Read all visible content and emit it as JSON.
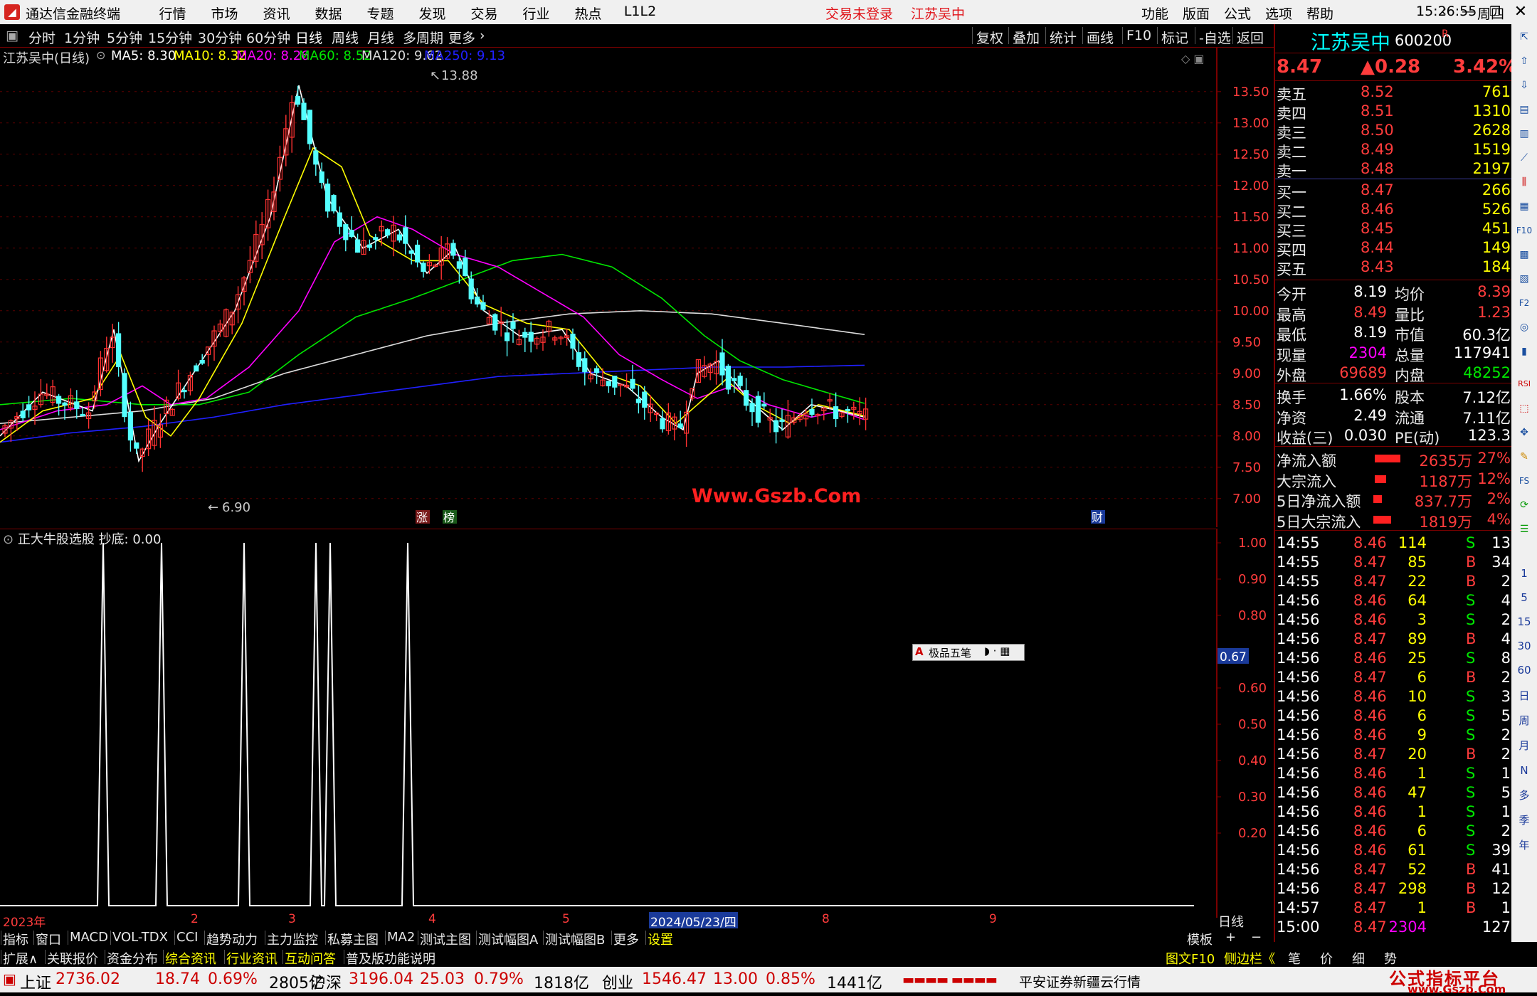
{
  "titlebar": {
    "app_name": "通达信金融终端",
    "menu": [
      "行情",
      "市场",
      "资讯",
      "数据",
      "专题",
      "发现",
      "交易",
      "行业",
      "热点",
      "L1L2"
    ],
    "login_status": "交易未登录",
    "stock_title": "江苏吴中",
    "right_menu": [
      "功能",
      "版面",
      "公式",
      "选项",
      "帮助"
    ],
    "time": "15:26:55",
    "weekday": "周四"
  },
  "toolbar": {
    "periods": [
      "分时",
      "1分钟",
      "5分钟",
      "15分钟",
      "30分钟",
      "60分钟",
      "日线",
      "周线",
      "月线",
      "多周期",
      "更多"
    ],
    "active_period": "日线",
    "right_buttons": [
      "复权",
      "叠加",
      "统计",
      "画线",
      "F10",
      "标记",
      "-自选",
      "返回"
    ]
  },
  "ma_legend": {
    "stock": "江苏吴中(日线)",
    "items": [
      {
        "label": "MA5: 8.30",
        "color": "#ffffff"
      },
      {
        "label": "MA10: 8.32",
        "color": "#ffff00"
      },
      {
        "label": "MA20: 8.26",
        "color": "#ff00ff"
      },
      {
        "label": "MA60: 8.52",
        "color": "#00e600"
      },
      {
        "label": "MA120: 9.62",
        "color": "#dcdcdc"
      },
      {
        "label": "MA250: 9.13",
        "color": "#2020ff"
      }
    ]
  },
  "chart_data": {
    "type": "candlestick",
    "price_axis": [
      "13.50",
      "13.00",
      "12.50",
      "12.00",
      "11.50",
      "11.00",
      "10.50",
      "10.00",
      "9.50",
      "9.00",
      "8.50",
      "8.00",
      "7.50",
      "7.00"
    ],
    "ylim": [
      6.6,
      14.1
    ],
    "high_label": "13.88",
    "low_label": "6.90",
    "date_axis": [
      "2023年",
      "2",
      "3",
      "4",
      "5",
      "2024/05/23/四",
      "8",
      "9"
    ],
    "watermark": "Www.Gszb.Com",
    "markers": [
      "涨",
      "榜",
      "财"
    ],
    "ma_keypoints": {
      "MA5": [
        [
          0,
          8.0
        ],
        [
          60,
          8.7
        ],
        [
          130,
          8.4
        ],
        [
          160,
          9.7
        ],
        [
          195,
          7.6
        ],
        [
          225,
          8.2
        ],
        [
          260,
          8.8
        ],
        [
          330,
          10.0
        ],
        [
          380,
          11.5
        ],
        [
          420,
          13.6
        ],
        [
          460,
          11.8
        ],
        [
          510,
          11.0
        ],
        [
          560,
          11.3
        ],
        [
          600,
          10.6
        ],
        [
          640,
          11.0
        ],
        [
          680,
          10.0
        ],
        [
          730,
          9.6
        ],
        [
          790,
          9.7
        ],
        [
          830,
          9.0
        ],
        [
          880,
          8.8
        ],
        [
          930,
          8.3
        ],
        [
          960,
          8.1
        ],
        [
          980,
          9.0
        ],
        [
          1010,
          9.2
        ],
        [
          1050,
          8.6
        ],
        [
          1100,
          8.1
        ],
        [
          1140,
          8.5
        ],
        [
          1180,
          8.4
        ],
        [
          1215,
          8.3
        ]
      ],
      "MA10": [
        [
          0,
          7.9
        ],
        [
          60,
          8.4
        ],
        [
          130,
          8.6
        ],
        [
          170,
          9.3
        ],
        [
          205,
          8.3
        ],
        [
          240,
          8.0
        ],
        [
          280,
          8.6
        ],
        [
          340,
          9.8
        ],
        [
          400,
          11.5
        ],
        [
          440,
          12.6
        ],
        [
          480,
          12.3
        ],
        [
          520,
          11.2
        ],
        [
          580,
          10.8
        ],
        [
          630,
          10.8
        ],
        [
          680,
          10.1
        ],
        [
          740,
          9.8
        ],
        [
          800,
          9.7
        ],
        [
          850,
          9.0
        ],
        [
          900,
          8.8
        ],
        [
          950,
          8.2
        ],
        [
          990,
          8.6
        ],
        [
          1020,
          8.9
        ],
        [
          1060,
          8.5
        ],
        [
          1110,
          8.2
        ],
        [
          1150,
          8.5
        ],
        [
          1215,
          8.32
        ]
      ],
      "MA20": [
        [
          0,
          8.1
        ],
        [
          80,
          8.4
        ],
        [
          150,
          8.5
        ],
        [
          200,
          8.8
        ],
        [
          240,
          8.5
        ],
        [
          290,
          8.6
        ],
        [
          350,
          9.1
        ],
        [
          420,
          10.0
        ],
        [
          470,
          11.1
        ],
        [
          530,
          11.5
        ],
        [
          580,
          11.3
        ],
        [
          640,
          10.9
        ],
        [
          700,
          10.7
        ],
        [
          760,
          10.3
        ],
        [
          820,
          9.9
        ],
        [
          870,
          9.3
        ],
        [
          930,
          8.9
        ],
        [
          980,
          8.6
        ],
        [
          1030,
          8.8
        ],
        [
          1080,
          8.5
        ],
        [
          1140,
          8.3
        ],
        [
          1180,
          8.4
        ],
        [
          1215,
          8.26
        ]
      ],
      "MA60": [
        [
          0,
          8.5
        ],
        [
          100,
          8.6
        ],
        [
          200,
          8.5
        ],
        [
          280,
          8.5
        ],
        [
          350,
          8.7
        ],
        [
          420,
          9.3
        ],
        [
          500,
          9.9
        ],
        [
          580,
          10.2
        ],
        [
          650,
          10.5
        ],
        [
          720,
          10.8
        ],
        [
          790,
          10.9
        ],
        [
          860,
          10.7
        ],
        [
          930,
          10.2
        ],
        [
          990,
          9.6
        ],
        [
          1040,
          9.2
        ],
        [
          1100,
          8.9
        ],
        [
          1160,
          8.7
        ],
        [
          1215,
          8.52
        ]
      ],
      "MA120": [
        [
          0,
          8.2
        ],
        [
          100,
          8.3
        ],
        [
          200,
          8.4
        ],
        [
          300,
          8.6
        ],
        [
          400,
          9.0
        ],
        [
          500,
          9.3
        ],
        [
          600,
          9.6
        ],
        [
          700,
          9.8
        ],
        [
          800,
          9.95
        ],
        [
          900,
          10.0
        ],
        [
          1000,
          9.95
        ],
        [
          1100,
          9.8
        ],
        [
          1215,
          9.62
        ]
      ],
      "MA250": [
        [
          0,
          7.9
        ],
        [
          100,
          8.05
        ],
        [
          200,
          8.15
        ],
        [
          300,
          8.3
        ],
        [
          400,
          8.5
        ],
        [
          500,
          8.65
        ],
        [
          600,
          8.8
        ],
        [
          700,
          8.95
        ],
        [
          800,
          9.0
        ],
        [
          900,
          9.05
        ],
        [
          1000,
          9.1
        ],
        [
          1100,
          9.1
        ],
        [
          1215,
          9.13
        ]
      ]
    }
  },
  "indicator": {
    "title": "正大牛股选股",
    "value_label": "抄底: 0.00",
    "axis": [
      "1.00",
      "0.90",
      "0.80",
      "0.60",
      "0.50",
      "0.40",
      "0.30",
      "0.20"
    ],
    "cursor_value": "0.67",
    "spikes": [
      145,
      227,
      343,
      444,
      464,
      573
    ],
    "ime_bar": "极品五笔"
  },
  "quote": {
    "name": "江苏吴中",
    "code": "600200",
    "flag": "R",
    "price": "8.47",
    "change": "▲0.28",
    "pct": "3.42%",
    "asks": [
      {
        "label": "卖五",
        "price": "8.52",
        "vol": "761"
      },
      {
        "label": "卖四",
        "price": "8.51",
        "vol": "1310"
      },
      {
        "label": "卖三",
        "price": "8.50",
        "vol": "2628"
      },
      {
        "label": "卖二",
        "price": "8.49",
        "vol": "1519"
      },
      {
        "label": "卖一",
        "price": "8.48",
        "vol": "2197"
      }
    ],
    "bids": [
      {
        "label": "买一",
        "price": "8.47",
        "vol": "266"
      },
      {
        "label": "买二",
        "price": "8.46",
        "vol": "526"
      },
      {
        "label": "买三",
        "price": "8.45",
        "vol": "451"
      },
      {
        "label": "买四",
        "price": "8.44",
        "vol": "149"
      },
      {
        "label": "买五",
        "price": "8.43",
        "vol": "184"
      }
    ],
    "stats": [
      {
        "l1": "今开",
        "v1": "8.19",
        "c1": "white",
        "l2": "均价",
        "v2": "8.39",
        "c2": "red"
      },
      {
        "l1": "最高",
        "v1": "8.49",
        "c1": "red",
        "l2": "量比",
        "v2": "1.23",
        "c2": "red"
      },
      {
        "l1": "最低",
        "v1": "8.19",
        "c1": "white",
        "l2": "市值",
        "v2": "60.3亿",
        "c2": "white"
      },
      {
        "l1": "现量",
        "v1": "2304",
        "c1": "magenta",
        "l2": "总量",
        "v2": "117941",
        "c2": "white"
      },
      {
        "l1": "外盘",
        "v1": "69689",
        "c1": "red",
        "l2": "内盘",
        "v2": "48252",
        "c2": "green"
      }
    ],
    "stats2": [
      {
        "l1": "换手",
        "v1": "1.66%",
        "l2": "股本",
        "v2": "7.12亿"
      },
      {
        "l1": "净资",
        "v1": "2.49",
        "l2": "流通",
        "v2": "7.11亿"
      },
      {
        "l1": "收益(三)",
        "v1": "0.030",
        "l2": "PE(动)",
        "v2": "123.3"
      }
    ],
    "flows": [
      {
        "label": "净流入额",
        "value": "2635万",
        "pct": "27%",
        "bar": 1.0
      },
      {
        "label": "大宗流入",
        "value": "1187万",
        "pct": "12%",
        "bar": 0.45
      },
      {
        "label": "5日净流入额",
        "value": "837.7万",
        "pct": "2%",
        "bar": 0.32
      },
      {
        "label": "5日大宗流入",
        "value": "1819万",
        "pct": "4%",
        "bar": 0.69
      }
    ],
    "ticks": [
      {
        "t": "14:55",
        "p": "8.46",
        "v": "114",
        "d": "S",
        "n": "13"
      },
      {
        "t": "14:55",
        "p": "8.47",
        "v": "85",
        "d": "B",
        "n": "34"
      },
      {
        "t": "14:55",
        "p": "8.47",
        "v": "22",
        "d": "B",
        "n": "2"
      },
      {
        "t": "14:56",
        "p": "8.46",
        "v": "64",
        "d": "S",
        "n": "4"
      },
      {
        "t": "14:56",
        "p": "8.46",
        "v": "3",
        "d": "S",
        "n": "2"
      },
      {
        "t": "14:56",
        "p": "8.47",
        "v": "89",
        "d": "B",
        "n": "4"
      },
      {
        "t": "14:56",
        "p": "8.46",
        "v": "25",
        "d": "S",
        "n": "8"
      },
      {
        "t": "14:56",
        "p": "8.47",
        "v": "6",
        "d": "B",
        "n": "2"
      },
      {
        "t": "14:56",
        "p": "8.46",
        "v": "10",
        "d": "S",
        "n": "3"
      },
      {
        "t": "14:56",
        "p": "8.46",
        "v": "6",
        "d": "S",
        "n": "5"
      },
      {
        "t": "14:56",
        "p": "8.46",
        "v": "9",
        "d": "S",
        "n": "2"
      },
      {
        "t": "14:56",
        "p": "8.47",
        "v": "20",
        "d": "B",
        "n": "2"
      },
      {
        "t": "14:56",
        "p": "8.46",
        "v": "1",
        "d": "S",
        "n": "1"
      },
      {
        "t": "14:56",
        "p": "8.46",
        "v": "47",
        "d": "S",
        "n": "5"
      },
      {
        "t": "14:56",
        "p": "8.46",
        "v": "1",
        "d": "S",
        "n": "1"
      },
      {
        "t": "14:56",
        "p": "8.46",
        "v": "6",
        "d": "S",
        "n": "2"
      },
      {
        "t": "14:56",
        "p": "8.46",
        "v": "61",
        "d": "S",
        "n": "39"
      },
      {
        "t": "14:56",
        "p": "8.47",
        "v": "52",
        "d": "B",
        "n": "41"
      },
      {
        "t": "14:56",
        "p": "8.47",
        "v": "298",
        "d": "B",
        "n": "12"
      },
      {
        "t": "14:57",
        "p": "8.47",
        "v": "1",
        "d": "B",
        "n": "1"
      },
      {
        "t": "15:00",
        "p": "8.47",
        "v": "2304",
        "d": "",
        "n": "127"
      }
    ]
  },
  "sidebar": [
    "1",
    "5",
    "15",
    "30",
    "60",
    "日",
    "周",
    "月",
    "N",
    "多",
    "季",
    "年"
  ],
  "tabs1": {
    "items": [
      "指标",
      "窗口",
      "MACD",
      "VOL-TDX",
      "CCI",
      "趋势动力",
      "主力监控",
      "私募主图",
      "MA2",
      "测试主图",
      "测试幅图A",
      "测试幅图B",
      "更多",
      "设置"
    ],
    "right": [
      "模板",
      "+",
      "−"
    ],
    "period_label": "日线"
  },
  "tabs2": {
    "items": [
      "扩展∧",
      "关联报价",
      "资金分布",
      "综合资讯",
      "行业资讯",
      "互动问答",
      "普及版功能说明"
    ],
    "right": [
      "图文F10",
      "侧边栏《",
      "笔",
      "价",
      "细",
      "势"
    ]
  },
  "status": {
    "sh_label": "上证",
    "sh_val": "2736.02",
    "sh_chg": "18.74",
    "sh_pct": "0.69%",
    "sh_amt": "2805亿",
    "hs_label": "沪深",
    "hs_val": "3196.04",
    "hs_chg": "25.03",
    "hs_pct": "0.79%",
    "hs_amt": "1818亿",
    "cy_label": "创业",
    "cy_val": "1546.47",
    "cy_chg": "13.00",
    "cy_pct": "0.85%",
    "cy_amt": "1441亿",
    "feed": "平安证券新疆云行情",
    "brand": "公式指标平台",
    "brand_url": "www.Gszb.Com"
  }
}
